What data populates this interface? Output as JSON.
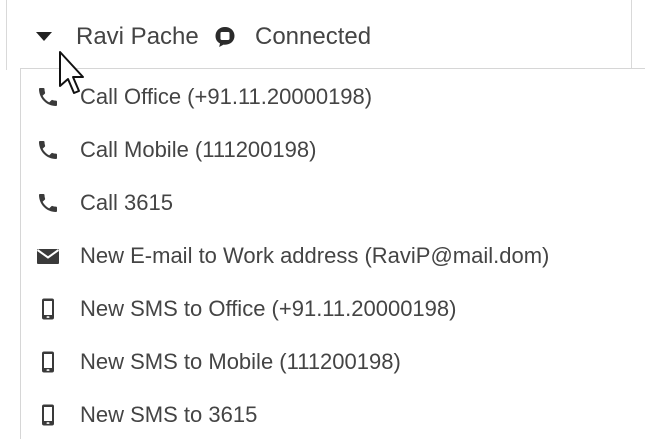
{
  "contact": {
    "name": "Ravi Pache",
    "status": "Connected",
    "expander_icon": "caret-down-icon",
    "status_icon": "chat-bubble-icon"
  },
  "menu": {
    "items": [
      {
        "label": "Call Office (+91.11.20000198)",
        "icon": "phone-icon"
      },
      {
        "label": "Call Mobile (111200198)",
        "icon": "phone-icon"
      },
      {
        "label": "Call 3615",
        "icon": "phone-icon"
      },
      {
        "label": "New E-mail to Work address (RaviP@mail.dom)",
        "icon": "envelope-icon"
      },
      {
        "label": "New SMS to Office (+91.11.20000198)",
        "icon": "mobile-phone-icon"
      },
      {
        "label": "New SMS to Mobile (111200198)",
        "icon": "mobile-phone-icon"
      },
      {
        "label": "New SMS to 3615",
        "icon": "mobile-phone-icon"
      }
    ]
  },
  "colors": {
    "text": "#444444",
    "icon": "#3a3a3a",
    "border": "#d6d6d6"
  }
}
